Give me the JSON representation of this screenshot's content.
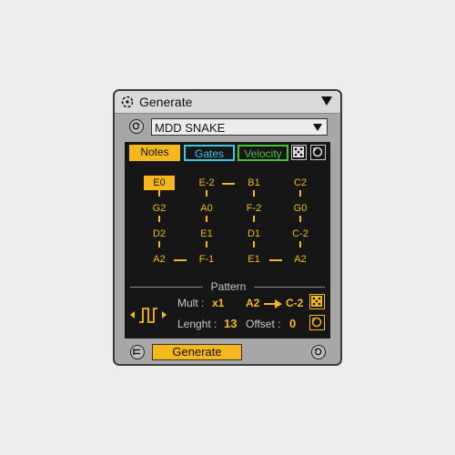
{
  "device": {
    "title": "Generate"
  },
  "preset": {
    "value": "MDD SNAKE"
  },
  "tabs": {
    "notes": "Notes",
    "gates": "Gates",
    "velocity": "Velocity"
  },
  "notes_grid": {
    "rows": [
      [
        "E0",
        "E-2",
        "B1",
        "C2"
      ],
      [
        "G2",
        "A0",
        "F-2",
        "G0"
      ],
      [
        "D2",
        "E1",
        "D1",
        "C-2"
      ],
      [
        "A2",
        "F-1",
        "E1",
        "A2"
      ]
    ],
    "selected": "E0"
  },
  "pattern": {
    "label": "Pattern",
    "mult_label": "Mult :",
    "mult_value": "x1",
    "length_label": "Lenght :",
    "length_value": "13",
    "offset_label": "Offset :",
    "offset_value": "0",
    "range_start": "A2",
    "range_end": "C-2"
  },
  "generate": {
    "label": "Generate"
  },
  "colors": {
    "accent": "#f5b81c",
    "gates": "#3ec8e8",
    "velocity": "#46c23a",
    "panel": "#161616"
  }
}
